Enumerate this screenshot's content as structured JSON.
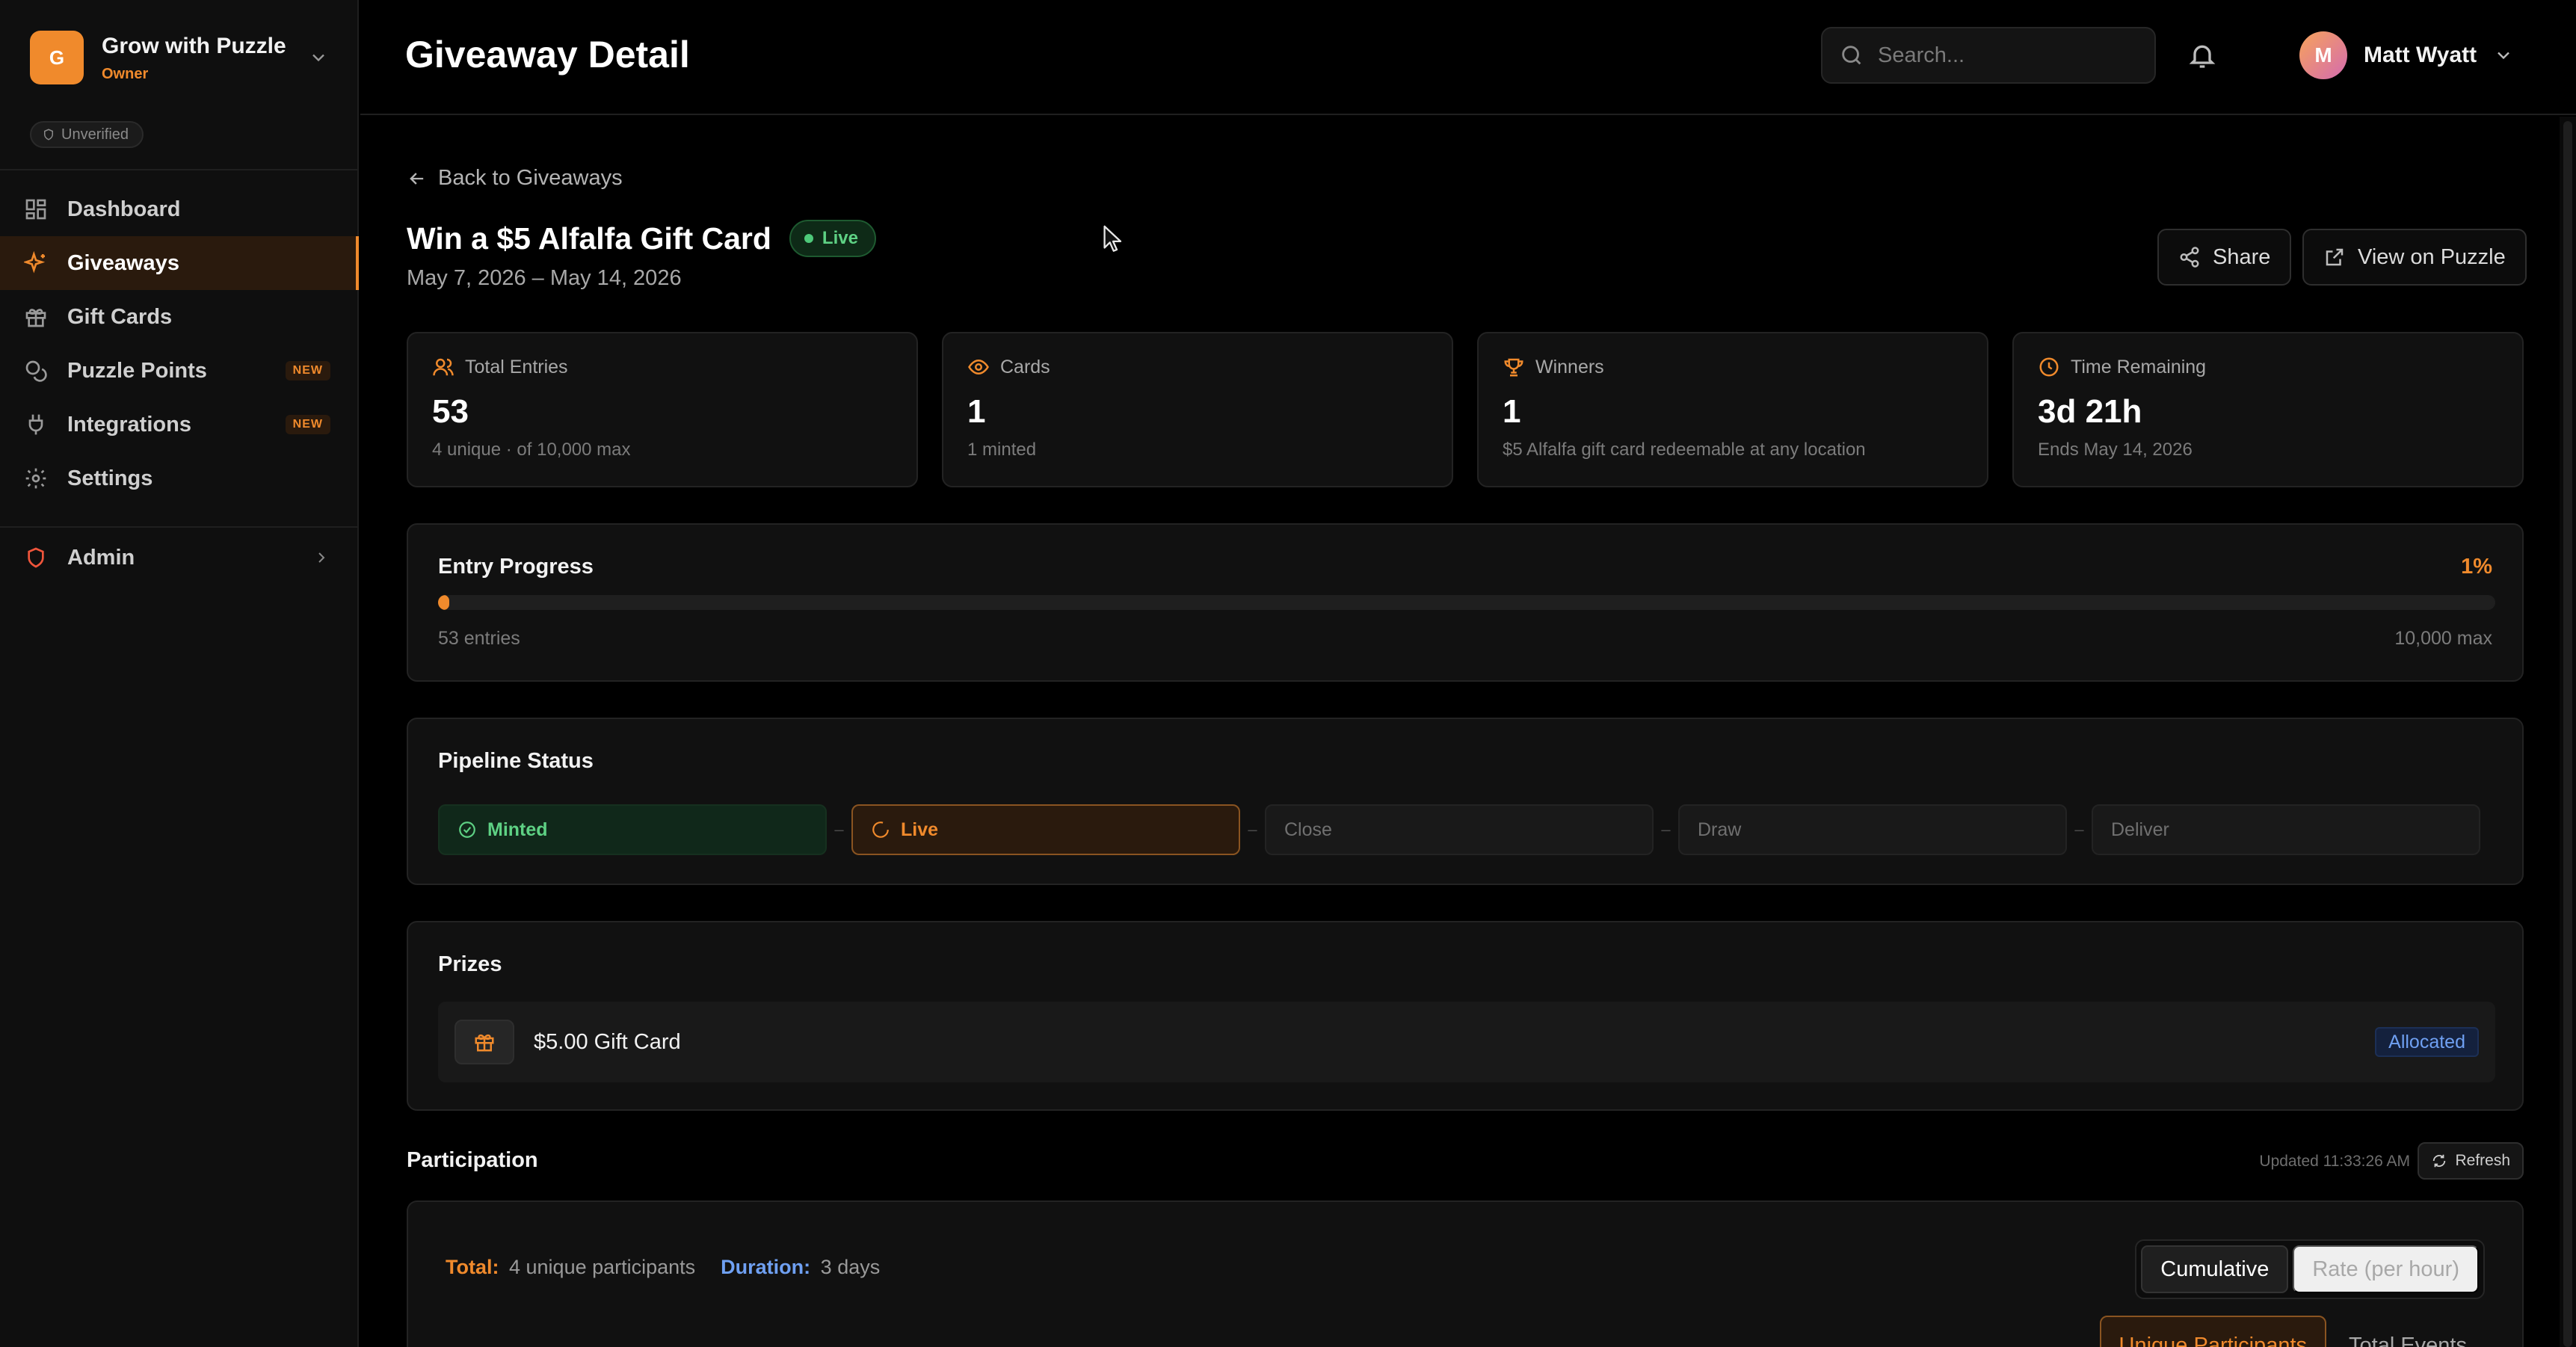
{
  "org": {
    "initial": "G",
    "name": "Grow with Puzzle",
    "role": "Owner",
    "verification": "Unverified"
  },
  "nav": {
    "items": [
      {
        "label": "Dashboard",
        "icon": "dashboard-icon"
      },
      {
        "label": "Giveaways",
        "icon": "sparkles-icon",
        "active": true
      },
      {
        "label": "Gift Cards",
        "icon": "gift-icon"
      },
      {
        "label": "Puzzle Points",
        "icon": "coins-icon",
        "badge": "NEW"
      },
      {
        "label": "Integrations",
        "icon": "plug-icon",
        "badge": "NEW"
      },
      {
        "label": "Settings",
        "icon": "gear-icon"
      }
    ],
    "admin": {
      "label": "Admin",
      "icon": "shield-icon"
    }
  },
  "header": {
    "title": "Giveaway Detail",
    "search_placeholder": "Search...",
    "user": {
      "initial": "M",
      "name": "Matt Wyatt"
    }
  },
  "giveaway": {
    "back_label": "Back to Giveaways",
    "title": "Win a $5 Alfalfa Gift Card",
    "status": "Live",
    "dates": "May 7, 2026 – May 14, 2026",
    "share_label": "Share",
    "view_label": "View on Puzzle"
  },
  "stats": [
    {
      "label": "Total Entries",
      "icon": "users-icon",
      "value": "53",
      "sub": "4 unique · of 10,000 max"
    },
    {
      "label": "Cards",
      "icon": "eye-icon",
      "value": "1",
      "sub": "1 minted"
    },
    {
      "label": "Winners",
      "icon": "trophy-icon",
      "value": "1",
      "sub": "$5 Alfalfa gift card redeemable at any location"
    },
    {
      "label": "Time Remaining",
      "icon": "clock-icon",
      "value": "3d 21h",
      "sub": "Ends May 14, 2026"
    }
  ],
  "progress": {
    "title": "Entry Progress",
    "percent_label": "1%",
    "fraction": 0.0053,
    "left_label": "53 entries",
    "right_label": "10,000 max"
  },
  "pipeline": {
    "title": "Pipeline Status",
    "stages": [
      {
        "label": "Minted",
        "state": "done"
      },
      {
        "label": "Live",
        "state": "current"
      },
      {
        "label": "Close",
        "state": "pending"
      },
      {
        "label": "Draw",
        "state": "pending"
      },
      {
        "label": "Deliver",
        "state": "pending"
      }
    ]
  },
  "prizes": {
    "title": "Prizes",
    "items": [
      {
        "name": "$5.00 Gift Card",
        "status": "Allocated"
      }
    ]
  },
  "participation": {
    "title": "Participation",
    "updated": "Updated 11:33:26 AM",
    "refresh_label": "Refresh",
    "total_label": "Total:",
    "total_value": "4 unique participants",
    "duration_label": "Duration:",
    "duration_value": "3 days",
    "modes": [
      "Cumulative",
      "Rate (per hour)"
    ],
    "metrics": [
      "Unique Participants",
      "Total Events"
    ]
  },
  "colors": {
    "accent": "#f08a2c",
    "success": "#5ed184",
    "info": "#6fa0f2"
  }
}
